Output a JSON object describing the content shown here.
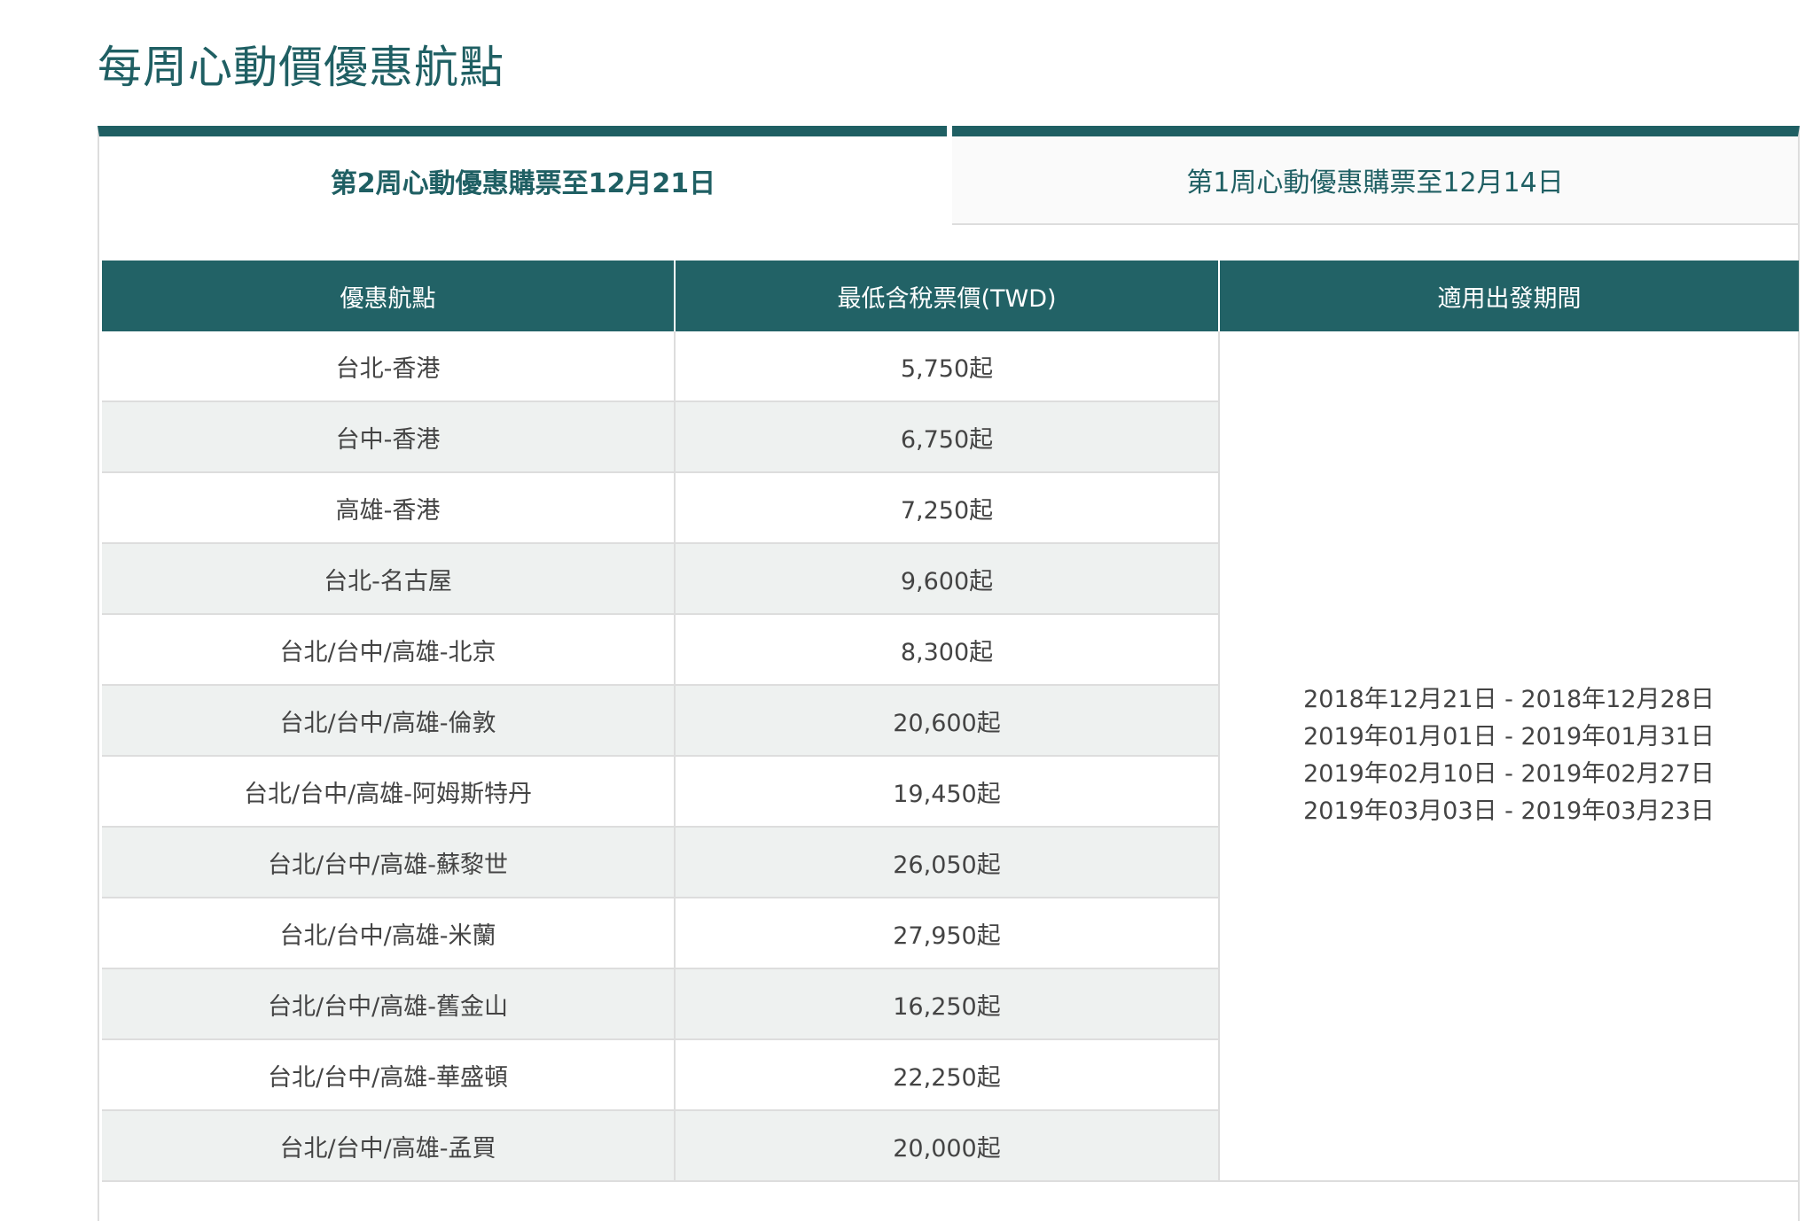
{
  "page": {
    "title": "每周心動價優惠航點"
  },
  "tabs": [
    {
      "label": "第2周心動優惠購票至12月21日",
      "active": true
    },
    {
      "label": "第1周心動優惠購票至12月14日",
      "active": false
    }
  ],
  "table": {
    "headers": [
      "優惠航點",
      "最低含稅票價(TWD)",
      "適用出發期間"
    ],
    "rows": [
      {
        "route": "台北-香港",
        "price": "5,750起"
      },
      {
        "route": "台中-香港",
        "price": "6,750起"
      },
      {
        "route": "高雄-香港",
        "price": "7,250起"
      },
      {
        "route": "台北-名古屋",
        "price": "9,600起"
      },
      {
        "route": "台北/台中/高雄-北京",
        "price": "8,300起"
      },
      {
        "route": "台北/台中/高雄-倫敦",
        "price": "20,600起"
      },
      {
        "route": "台北/台中/高雄-阿姆斯特丹",
        "price": "19,450起"
      },
      {
        "route": "台北/台中/高雄-蘇黎世",
        "price": "26,050起"
      },
      {
        "route": "台北/台中/高雄-米蘭",
        "price": "27,950起"
      },
      {
        "route": "台北/台中/高雄-舊金山",
        "price": "16,250起"
      },
      {
        "route": "台北/台中/高雄-華盛頓",
        "price": "22,250起"
      },
      {
        "route": "台北/台中/高雄-孟買",
        "price": "20,000起"
      }
    ],
    "periods": [
      "2018年12月21日 - 2018年12月28日",
      "2019年01月01日 - 2019年01月31日",
      "2019年02月10日 - 2019年02月27日",
      "2019年03月03日 - 2019年03月23日"
    ]
  },
  "colors": {
    "brand": "#1f5f63",
    "header_bg": "#226266",
    "alt_row": "#eef1f0",
    "border": "#dddddd"
  }
}
